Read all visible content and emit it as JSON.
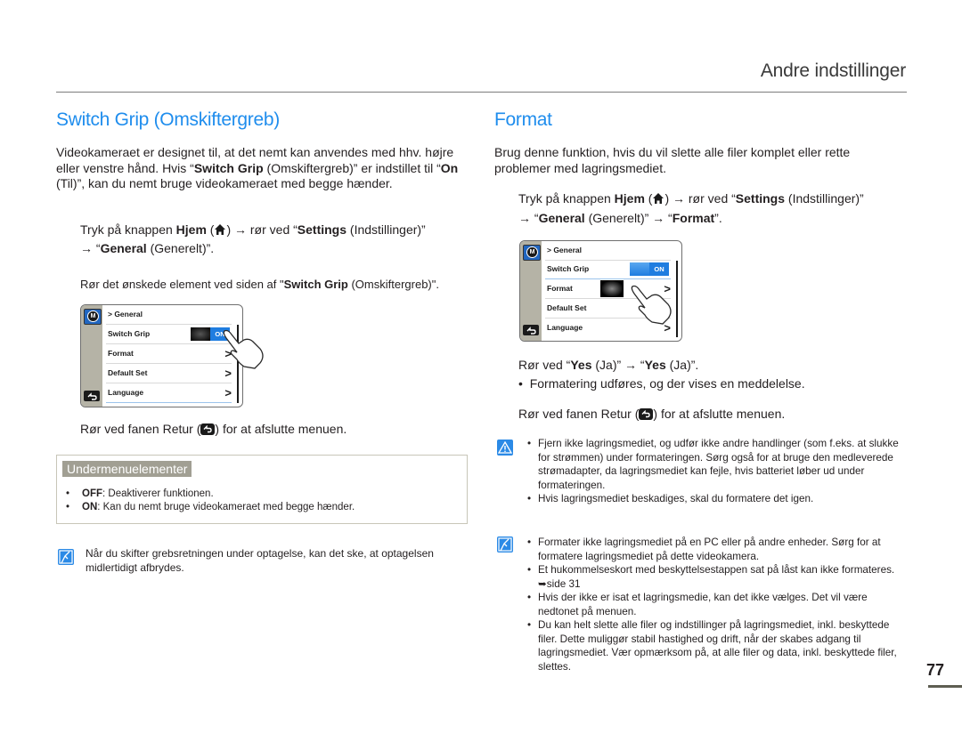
{
  "page": {
    "section_title": "Andre indstillinger",
    "page_number": "77"
  },
  "left": {
    "heading": "Switch Grip (Omskiftergreb)",
    "intro": {
      "p1": "Videokameraet er designet til, at det nemt kan anvendes med hhv. højre eller venstre hånd. Hvis “",
      "b1": "Switch Grip",
      "p2": " (Omskiftergreb)” er indstillet til “",
      "b2": "On",
      "p3": " (Til)”, kan du nemt bruge videokameraet med begge hænder."
    },
    "step1": {
      "t1": "Tryk på knappen ",
      "b1": "Hjem",
      "t2": " (",
      "t3": ") → rør ved “",
      "b2": "Settings",
      "t4": " (Indstillinger)”",
      "t5": "→ “",
      "b3": "General",
      "t6": " (Generelt)”."
    },
    "step2": {
      "t1": "Rør det ønskede element ved siden af \"",
      "b1": "Switch Grip",
      "t2": " (Omskiftergreb)\"."
    },
    "screen": {
      "breadcrumb": "> General",
      "rows": [
        "Switch Grip",
        "Format",
        "Default Set",
        "Language"
      ],
      "toggle_label": "ON",
      "mode_label": "M"
    },
    "step3": {
      "t1": "Rør ved fanen Retur (",
      "t2": ") for at afslutte menuen."
    },
    "submenu": {
      "title": "Undermenuelementer",
      "items": [
        {
          "key": "OFF",
          "text": ": Deaktiverer funktionen."
        },
        {
          "key": "ON",
          "text": ": Kan du nemt bruge videokameraet med begge hænder."
        }
      ]
    },
    "note": "Når du skifter grebsretningen under optagelse, kan det ske, at optagelsen midlertidigt afbrydes."
  },
  "right": {
    "heading": "Format",
    "intro": "Brug denne funktion, hvis du vil slette alle filer komplet eller rette problemer med lagringsmediet.",
    "step1": {
      "t1": "Tryk på knappen ",
      "b1": "Hjem",
      "t2": " (",
      "t3": ") → rør ved “",
      "b2": "Settings",
      "t4": " (Indstillinger)”",
      "t5": "→ “",
      "b3": "General",
      "t6": " (Generelt)” → “",
      "b4": "Format",
      "t7": "”."
    },
    "screen": {
      "breadcrumb": "> General",
      "rows": [
        "Switch Grip",
        "Format",
        "Default Set",
        "Language"
      ],
      "toggle_label": "ON",
      "mode_label": "M"
    },
    "step2": {
      "t1": "Rør ved “",
      "b1": "Yes",
      "t2": " (Ja)” → “",
      "b2": "Yes",
      "t3": " (Ja)”."
    },
    "step2_bullet": "Formatering udføres, og der vises en meddelelse.",
    "step3": {
      "t1": "Rør ved fanen Retur (",
      "t2": ") for at afslutte menuen."
    },
    "warning_items": [
      "Fjern ikke lagringsmediet, og udfør ikke andre handlinger (som f.eks. at slukke for strømmen) under formateringen. Sørg også for at bruge den medleverede strømadapter, da lagringsmediet kan fejle, hvis batteriet løber ud under formateringen.",
      "Hvis lagringsmediet beskadiges, skal du formatere det igen."
    ],
    "note_items": [
      "Formater ikke lagringsmediet på en PC eller på andre enheder. Sørg for at formatere lagringsmediet på dette videokamera.",
      "Et hukommelseskort med beskyttelsestappen sat på låst kan ikke formateres. ➥side 31",
      "Hvis der ikke er isat et lagringsmedie, kan det ikke vælges. Det vil være nedtonet på menuen.",
      "Du kan helt slette alle filer og indstillinger på lagringsmediet, inkl. beskyttede filer. Dette muliggør stabil hastighed og drift, når der skabes adgang til lagringsmediet. Vær opmærksom på, at alle filer og data, inkl. beskyttede filer, slettes."
    ]
  },
  "icons": {
    "home": "home-icon",
    "back": "back-icon",
    "note": "note-pencil-icon",
    "warning": "warning-icon",
    "hand": "hand-pointer-icon"
  },
  "colors": {
    "heading_blue": "#1f8ded",
    "icon_blue": "#2b8ae6",
    "submenu_tag_bg": "#a19f93"
  }
}
